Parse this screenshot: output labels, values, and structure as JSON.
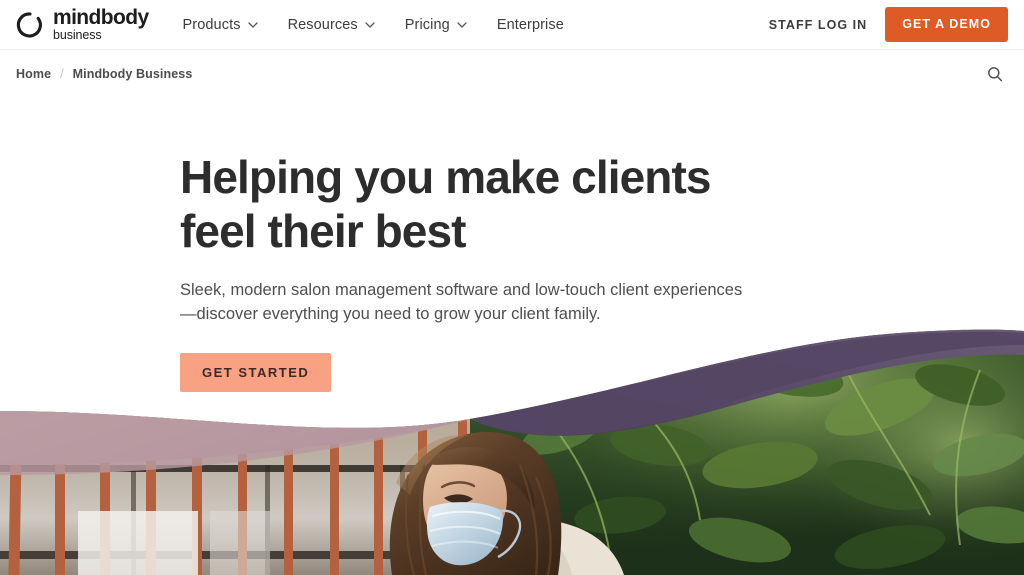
{
  "header": {
    "logo": {
      "mark": "open-circle-logo-mark",
      "word": "mindbody",
      "sub": "business"
    },
    "nav": [
      {
        "label": "Products",
        "has_dropdown": true
      },
      {
        "label": "Resources",
        "has_dropdown": true
      },
      {
        "label": "Pricing",
        "has_dropdown": true
      },
      {
        "label": "Enterprise",
        "has_dropdown": false
      }
    ],
    "staff_login_label": "STAFF LOG IN",
    "demo_button_label": "GET A DEMO",
    "demo_button_color": "#DE5B25"
  },
  "breadcrumb": {
    "home_label": "Home",
    "separator": "/",
    "current_label": "Mindbody Business",
    "search_icon": "search-icon"
  },
  "hero": {
    "title_line1": "Helping you make clients",
    "title_line2": "feel their best",
    "subtitle": "Sleek, modern salon management software and low-touch client experiences—discover everything you need to grow your client family.",
    "cta_label": "GET STARTED",
    "cta_color": "#F8A183",
    "title_color": "#2D2D2D",
    "image_description": "Woman with long brown hair wearing a light blue surgical mask standing in front of a wall of green foliage, with a window of terracotta mullions at left",
    "overlay_rose": "#C2A2A9",
    "overlay_purple": "#584A66"
  }
}
